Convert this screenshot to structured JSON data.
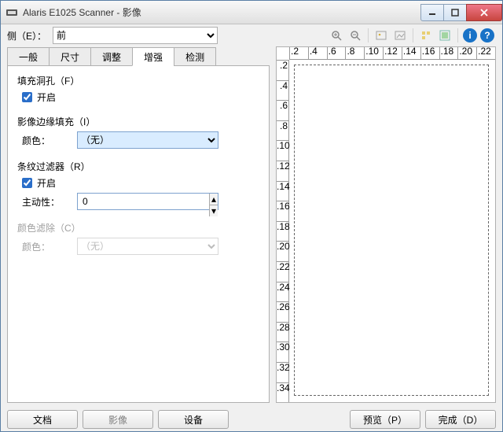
{
  "window": {
    "title": "Alaris E1025 Scanner - 影像"
  },
  "side": {
    "label": "侧（E）：",
    "value": "前"
  },
  "toolbar": {
    "icon_zoom_in": "zoom-in-icon",
    "icon_zoom_out": "zoom-out-icon",
    "icon_img1": "image-icon",
    "icon_img2": "image-tool-icon",
    "icon_opt1": "options-icon",
    "icon_opt2": "options2-icon",
    "help_info": "i",
    "help_q": "?"
  },
  "tabs": [
    "一般",
    "尺寸",
    "调整",
    "增强",
    "检测"
  ],
  "active_tab": "增强",
  "groups": {
    "fill_holes": {
      "title": "填充洞孔（F）",
      "checkbox": "开启",
      "checked": true
    },
    "edge_fill": {
      "title": "影像边缘填充（I）",
      "color_label": "颜色：",
      "color_value": "（无）"
    },
    "streak": {
      "title": "条纹过滤器（R）",
      "checkbox": "开启",
      "checked": true,
      "aggr_label": "主动性：",
      "aggr_value": "0"
    },
    "dropout": {
      "title": "颜色滤除（C）",
      "color_label": "颜色：",
      "color_value": "（无）"
    }
  },
  "ruler_h": [
    ".2",
    ".4",
    ".6",
    ".8",
    ".10",
    ".12",
    ".14",
    ".16",
    ".18",
    ".20",
    ".22"
  ],
  "ruler_v": [
    ".2",
    ".4",
    ".6",
    ".8",
    ".10",
    ".12",
    ".14",
    ".16",
    ".18",
    ".20",
    ".22",
    ".24",
    ".26",
    ".28",
    ".30",
    ".32",
    ".34"
  ],
  "buttons": {
    "doc": "文档",
    "image": "影像",
    "device": "设备",
    "preview": "预览（P）",
    "done": "完成（D）"
  }
}
